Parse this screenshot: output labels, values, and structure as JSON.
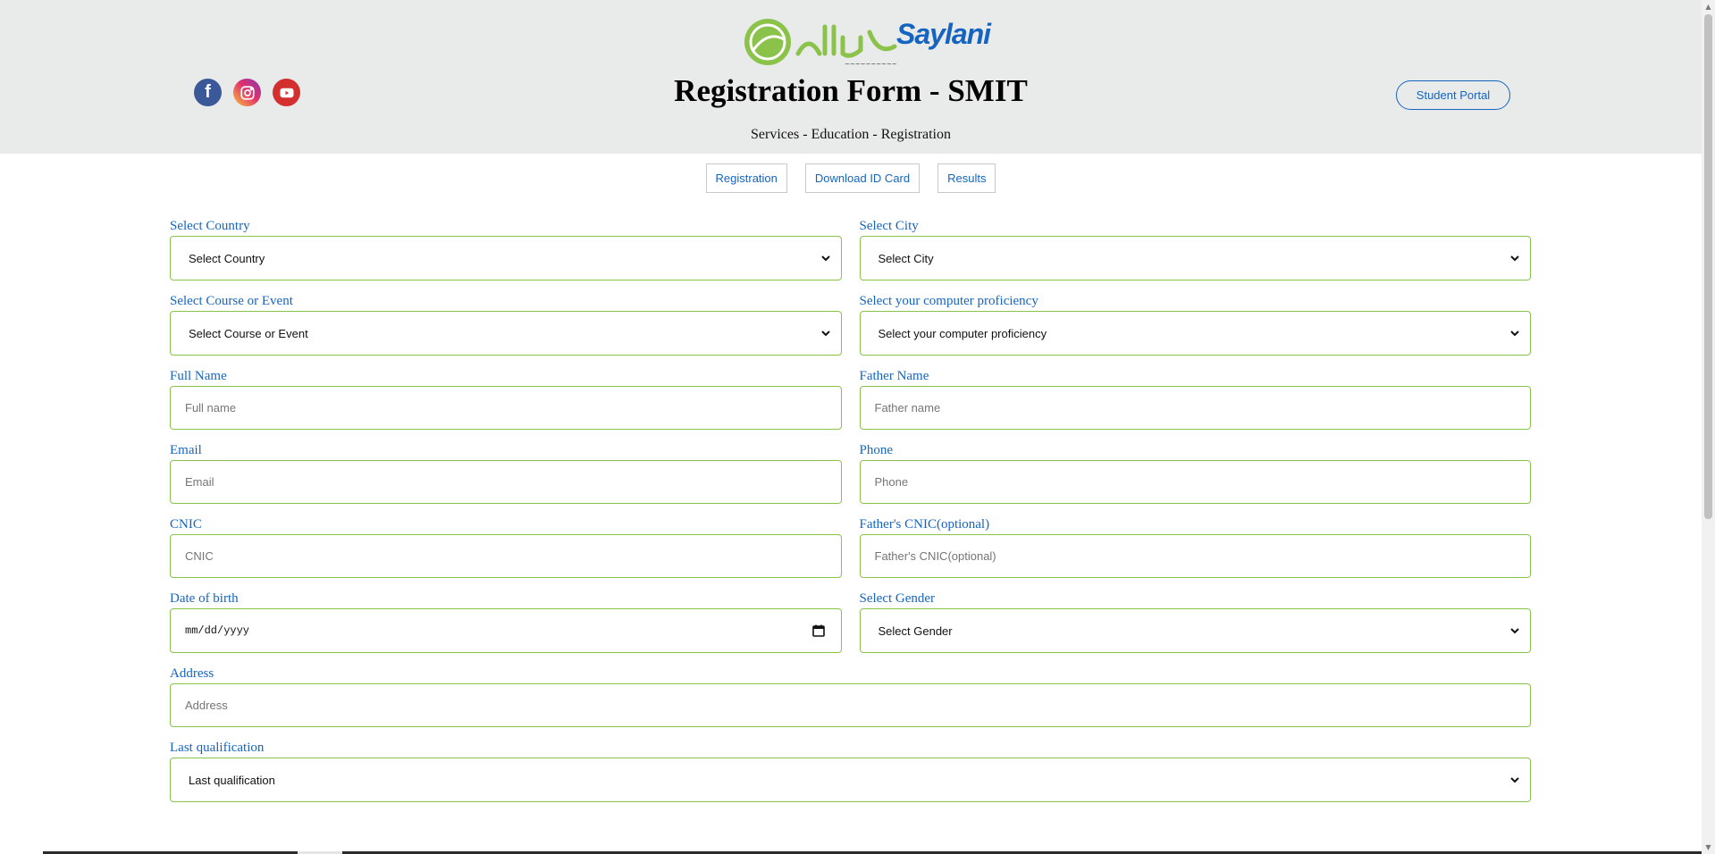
{
  "header": {
    "logo_text": "Saylani",
    "title": "Registration Form - SMIT",
    "subtitle": "Services - Education - Registration",
    "portal_button": "Student Portal",
    "socials": [
      {
        "name": "facebook-icon",
        "glyph": "f"
      },
      {
        "name": "instagram-icon"
      },
      {
        "name": "youtube-icon"
      }
    ]
  },
  "nav": {
    "items": [
      "Registration",
      "Download ID Card",
      "Results"
    ]
  },
  "form": {
    "country": {
      "label": "Select Country",
      "value": "Select Country"
    },
    "city": {
      "label": "Select City",
      "value": "Select City"
    },
    "course": {
      "label": "Select Course or Event",
      "value": "Select Course or Event"
    },
    "proficiency": {
      "label": "Select your computer proficiency",
      "value": "Select your computer proficiency"
    },
    "full_name": {
      "label": "Full Name",
      "placeholder": "Full name"
    },
    "father_name": {
      "label": "Father Name",
      "placeholder": "Father name"
    },
    "email": {
      "label": "Email",
      "placeholder": "Email"
    },
    "phone": {
      "label": "Phone",
      "placeholder": "Phone"
    },
    "cnic": {
      "label": "CNIC",
      "placeholder": "CNIC"
    },
    "father_cnic": {
      "label": "Father's CNIC(optional)",
      "placeholder": "Father's CNIC(optional)"
    },
    "dob": {
      "label": "Date of birth",
      "value": "mm/dd/yyyy"
    },
    "gender": {
      "label": "Select Gender",
      "value": "Select Gender"
    },
    "address": {
      "label": "Address",
      "placeholder": "Address"
    },
    "qualification": {
      "label": "Last qualification",
      "value": "Last qualification"
    }
  },
  "colors": {
    "accent": "#1565c0",
    "field_border": "#8bc34a",
    "header_bg": "#e9eaea"
  }
}
